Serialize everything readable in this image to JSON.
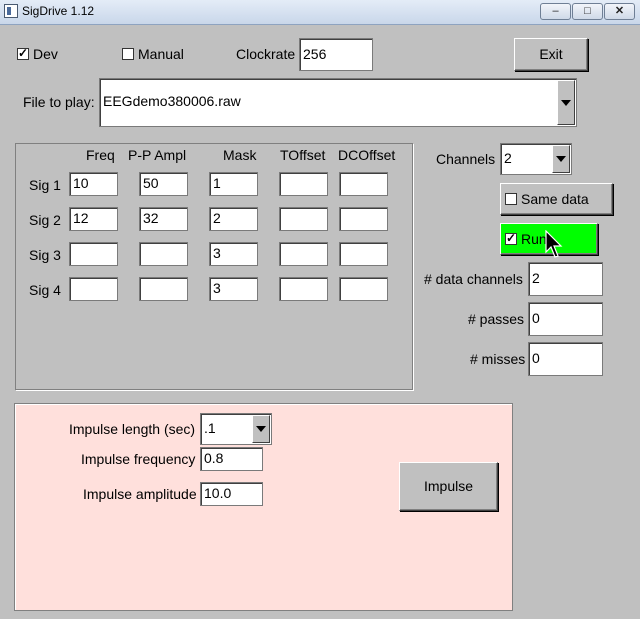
{
  "window": {
    "title": "SigDrive 1.12"
  },
  "top": {
    "dev": {
      "label": "Dev",
      "checked": true
    },
    "manual": {
      "label": "Manual",
      "checked": false
    },
    "clockrate_label": "Clockrate",
    "clockrate_value": "256",
    "exit_label": "Exit"
  },
  "file": {
    "label": "File to play:",
    "value": "EEGdemo380006.raw"
  },
  "signals": {
    "headers": [
      "Freq",
      "P-P Ampl",
      "Mask",
      "TOffset",
      "DCOffset"
    ],
    "rows": [
      {
        "label": "Sig 1",
        "freq": "10",
        "ampl": "50",
        "mask": "1",
        "toffset": "",
        "dcoffset": ""
      },
      {
        "label": "Sig 2",
        "freq": "12",
        "ampl": "32",
        "mask": "2",
        "toffset": "",
        "dcoffset": ""
      },
      {
        "label": "Sig 3",
        "freq": "",
        "ampl": "",
        "mask": "3",
        "toffset": "",
        "dcoffset": ""
      },
      {
        "label": "Sig 4",
        "freq": "",
        "ampl": "",
        "mask": "3",
        "toffset": "",
        "dcoffset": ""
      }
    ]
  },
  "right": {
    "channels_label": "Channels",
    "channels_value": "2",
    "same_data": {
      "label": "Same data",
      "checked": false
    },
    "run": {
      "label": "Run",
      "checked": true,
      "color": "#00ff00"
    },
    "data_channels_label": "# data channels",
    "data_channels_value": "2",
    "passes_label": "# passes",
    "passes_value": "0",
    "misses_label": "# misses",
    "misses_value": "0"
  },
  "impulse": {
    "panel_color": "#ffe0dc",
    "length_label": "Impulse length (sec)",
    "length_value": ".1",
    "frequency_label": "Impulse frequency",
    "frequency_value": "0.8",
    "amplitude_label": "Impulse amplitude",
    "amplitude_value": "10.0",
    "button_label": "Impulse"
  }
}
